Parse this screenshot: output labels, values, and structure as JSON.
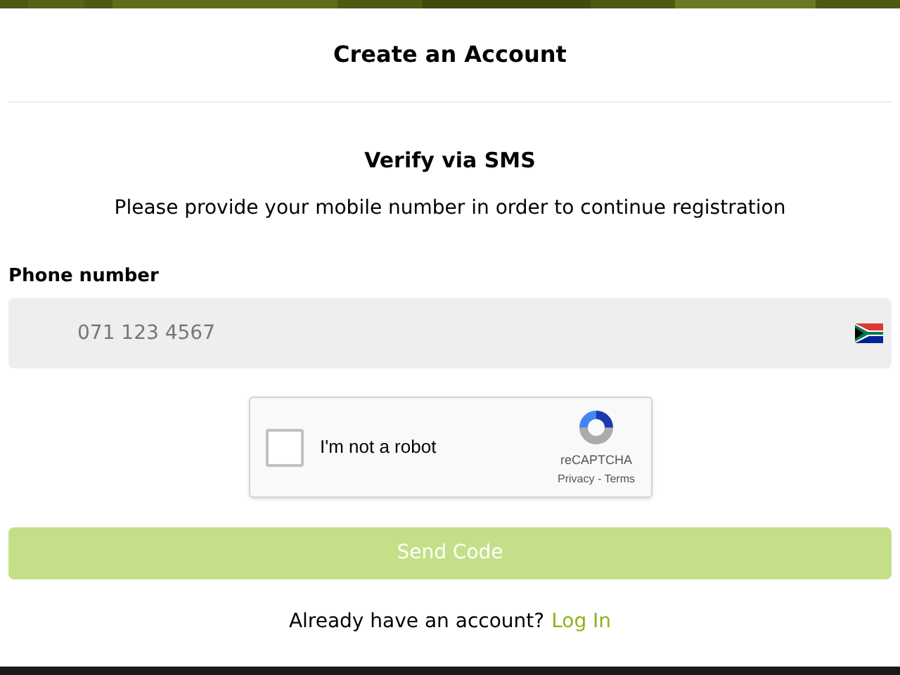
{
  "header": {
    "title": "Create an Account"
  },
  "verify": {
    "heading": "Verify via SMS",
    "description": "Please provide your mobile number in order to continue registration"
  },
  "phone": {
    "label": "Phone number",
    "placeholder": "071 123 4567"
  },
  "captcha": {
    "checked": false,
    "label": "I'm not a robot",
    "brand": "reCAPTCHA",
    "links": "Privacy - Terms"
  },
  "submit": {
    "label": "Send Code",
    "disabled": true
  },
  "login": {
    "prompt": "Already have an account?",
    "link": "Log In"
  }
}
